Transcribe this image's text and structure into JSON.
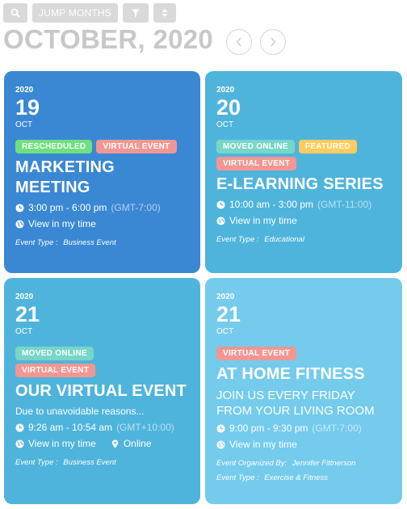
{
  "toolbar": {
    "search_icon": "search-icon",
    "jump_label": "JUMP MONTHS",
    "filter_icon": "filter-icon",
    "sort_icon": "sort-icon"
  },
  "header": {
    "month_title": "OCTOBER, 2020",
    "prev_icon": "chevron-left-icon",
    "next_icon": "chevron-right-icon"
  },
  "colors": {
    "card1": "#3a88d3",
    "card2": "#4fb4dc",
    "card3": "#4fb4dc",
    "card4": "#74cbec",
    "tag_rescheduled": "#6ee07f",
    "tag_virtual": "#f39693",
    "tag_moved_online": "#76d6c7",
    "tag_featured": "#ffcb5c"
  },
  "events": [
    {
      "year": "2020",
      "day": "19",
      "month": "OCT",
      "tags": [
        "RESCHEDULED",
        "VIRTUAL EVENT"
      ],
      "title_lines": [
        "MARKETING",
        "MEETING"
      ],
      "time": "3:00 pm - 6:00 pm",
      "timezone": "(GMT-7:00)",
      "view_local": "View in my time",
      "event_type_label": "Event Type :",
      "event_type": "Business Event"
    },
    {
      "year": "2020",
      "day": "20",
      "month": "OCT",
      "tags": [
        "MOVED ONLINE",
        "FEATURED",
        "VIRTUAL EVENT"
      ],
      "title": "E-LEARNING SERIES",
      "time": "10:00 am - 3:00 pm",
      "timezone": "(GMT-11:00)",
      "view_local": "View in my time",
      "event_type_label": "Event Type :",
      "event_type": "Educational"
    },
    {
      "year": "2020",
      "day": "21",
      "month": "OCT",
      "tags": [
        "MOVED ONLINE",
        "VIRTUAL EVENT"
      ],
      "title": "OUR VIRTUAL EVENT",
      "excerpt": "Due to unavoidable reasons...",
      "time": "9:26 am - 10:54 am",
      "timezone": "(GMT+10:00)",
      "view_local": "View in my time",
      "location": "Online",
      "event_type_label": "Event Type :",
      "event_type": "Business Event"
    },
    {
      "year": "2020",
      "day": "21",
      "month": "OCT",
      "tags": [
        "VIRTUAL EVENT"
      ],
      "title": "AT HOME FITNESS",
      "subtitle_lines": [
        "JOIN US EVERY FRIDAY",
        "FROM YOUR LIVING ROOM"
      ],
      "time": "9:00 pm - 9:30 pm",
      "timezone": "(GMT-7:00)",
      "view_local": "View in my time",
      "organizer_label": "Event Organized By:",
      "organizer": "Jennifer Fittnerson",
      "event_type_label": "Event Type :",
      "event_type": "Exercise & Fitness"
    }
  ]
}
